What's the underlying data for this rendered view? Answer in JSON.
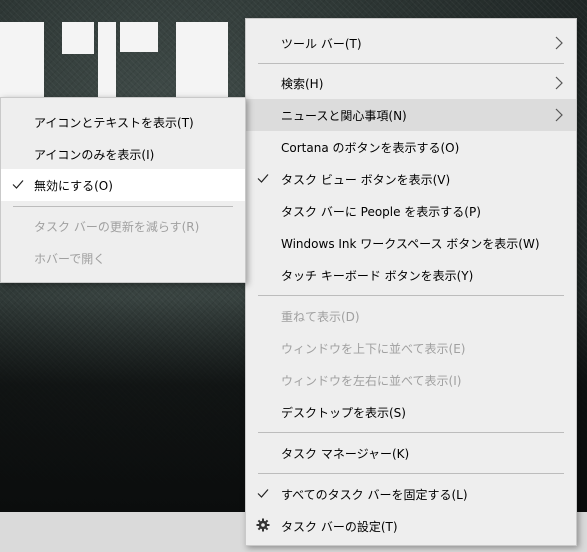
{
  "main_menu": {
    "items": [
      {
        "label": "ツール バー(T)",
        "submenu": true
      },
      {
        "label": "検索(H)",
        "submenu": true
      },
      {
        "label": "ニュースと関心事項(N)",
        "submenu": true,
        "open": true
      },
      {
        "label": "Cortana のボタンを表示する(O)"
      },
      {
        "label": "タスク ビュー ボタンを表示(V)",
        "checked": true
      },
      {
        "label": "タスク バーに People を表示する(P)"
      },
      {
        "label": "Windows Ink ワークスペース ボタンを表示(W)"
      },
      {
        "label": "タッチ キーボード ボタンを表示(Y)"
      },
      {
        "label": "重ねて表示(D)",
        "disabled": true
      },
      {
        "label": "ウィンドウを上下に並べて表示(E)",
        "disabled": true
      },
      {
        "label": "ウィンドウを左右に並べて表示(I)",
        "disabled": true
      },
      {
        "label": "デスクトップを表示(S)"
      },
      {
        "label": "タスク マネージャー(K)"
      },
      {
        "label": "すべてのタスク バーを固定する(L)",
        "checked": true
      },
      {
        "label": "タスク バーの設定(T)",
        "icon": "gear-icon"
      }
    ]
  },
  "sub_menu": {
    "items": [
      {
        "label": "アイコンとテキストを表示(T)"
      },
      {
        "label": "アイコンのみを表示(I)"
      },
      {
        "label": "無効にする(O)",
        "checked": true,
        "highlighted": true
      },
      {
        "label": "タスク バーの更新を減らす(R)",
        "disabled": true
      },
      {
        "label": "ホバーで開く",
        "disabled": true
      }
    ]
  },
  "colors": {
    "menu_bg": "#eeeeee",
    "hover_bg": "#dcdcdc",
    "disabled_text": "#a0a0a0",
    "separator": "#bcbcbc"
  }
}
